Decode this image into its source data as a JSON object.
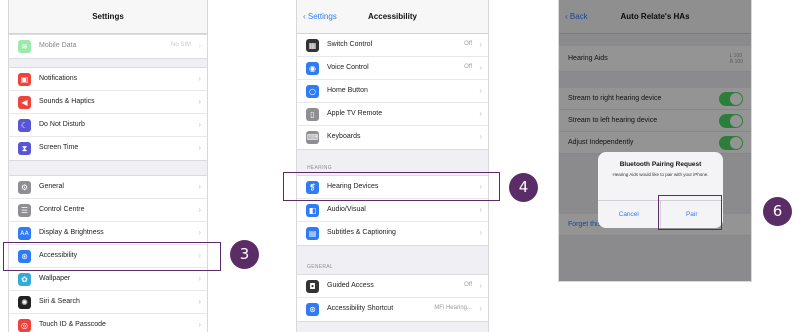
{
  "colors": {
    "accent": "#5b2d66",
    "ios_blue": "#2f7bf5",
    "toggle_on": "#4cd964"
  },
  "screen1": {
    "title": "Settings",
    "top_row": {
      "label": "Mobile Data",
      "value": "No SIM",
      "icon": "antenna-icon",
      "color": "#4cd964"
    },
    "group1": [
      {
        "label": "Notifications",
        "icon": "notifications-icon",
        "color": "#f0413a"
      },
      {
        "label": "Sounds & Haptics",
        "icon": "speaker-icon",
        "color": "#f0413a"
      },
      {
        "label": "Do Not Disturb",
        "icon": "moon-icon",
        "color": "#5856d6"
      },
      {
        "label": "Screen Time",
        "icon": "hourglass-icon",
        "color": "#5856d6"
      }
    ],
    "group2": [
      {
        "label": "General",
        "icon": "gear-icon",
        "color": "#8e8e93"
      },
      {
        "label": "Control Centre",
        "icon": "sliders-icon",
        "color": "#8e8e93"
      },
      {
        "label": "Display & Brightness",
        "icon": "text-size-icon",
        "color": "#2f7bf5"
      },
      {
        "label": "Accessibility",
        "icon": "accessibility-icon",
        "color": "#2f7bf5"
      },
      {
        "label": "Wallpaper",
        "icon": "flower-icon",
        "color": "#34aadc"
      },
      {
        "label": "Siri & Search",
        "icon": "siri-icon",
        "color": "#222222"
      },
      {
        "label": "Touch ID & Passcode",
        "icon": "fingerprint-icon",
        "color": "#f0413a"
      }
    ],
    "step": "3"
  },
  "screen2": {
    "back_label": "Settings",
    "title": "Accessibility",
    "group1": [
      {
        "label": "Switch Control",
        "value": "Off",
        "icon": "switch-control-icon",
        "color": "#333333"
      },
      {
        "label": "Voice Control",
        "value": "Off",
        "icon": "voice-control-icon",
        "color": "#2f7bf5"
      },
      {
        "label": "Home Button",
        "value": "",
        "icon": "home-button-icon",
        "color": "#2f7bf5"
      },
      {
        "label": "Apple TV Remote",
        "value": "",
        "icon": "remote-icon",
        "color": "#8e8e93"
      },
      {
        "label": "Keyboards",
        "value": "",
        "icon": "keyboard-icon",
        "color": "#8e8e93"
      }
    ],
    "hearing_header": "HEARING",
    "group2": [
      {
        "label": "Hearing Devices",
        "value": "",
        "icon": "ear-icon",
        "color": "#2f7bf5"
      },
      {
        "label": "Audio/Visual",
        "value": "",
        "icon": "audio-visual-icon",
        "color": "#2f7bf5"
      },
      {
        "label": "Subtitles & Captioning",
        "value": "",
        "icon": "captions-icon",
        "color": "#2f7bf5"
      }
    ],
    "general_header": "GENERAL",
    "group3": [
      {
        "label": "Guided Access",
        "value": "Off",
        "icon": "lock-icon",
        "color": "#333333"
      },
      {
        "label": "Accessibility Shortcut",
        "value": "MFi Hearing...",
        "icon": "accessibility-icon",
        "color": "#2f7bf5"
      }
    ],
    "step": "4"
  },
  "screen3": {
    "back_label": "Back",
    "title": "Auto Relate's HAs",
    "device_row": {
      "label": "Hearing Aids",
      "value": "L 100\nR 100"
    },
    "toggles": [
      {
        "label": "Stream to right hearing device"
      },
      {
        "label": "Stream to left hearing device"
      },
      {
        "label": "Adjust Independently"
      }
    ],
    "footer_link": "Forget this device",
    "alert": {
      "title": "Bluetooth Pairing Request",
      "message": "Hearing Aids would like to pair with your iPhone.",
      "cancel_label": "Cancel",
      "pair_label": "Pair"
    },
    "step": "6"
  }
}
